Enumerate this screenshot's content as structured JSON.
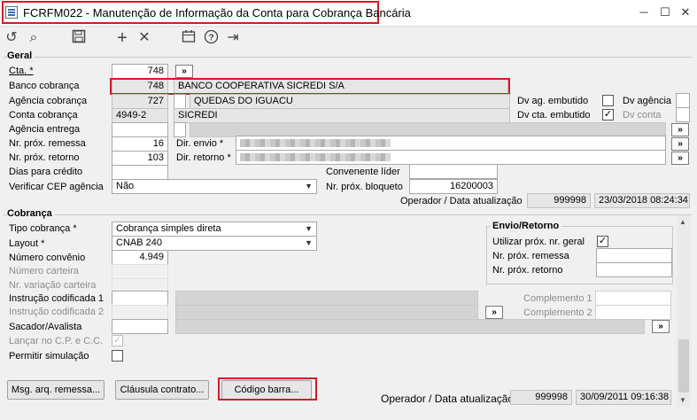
{
  "window": {
    "title": "FCRFM022 - Manutenção de Informação da Conta para Cobrança Bancária"
  },
  "toolbar": {
    "undo": "↺",
    "search": "⌕",
    "save": "💾",
    "add": "+",
    "close": "✕",
    "calendar": "📅",
    "help": "?",
    "exit": "⇥"
  },
  "geral": {
    "title": "Geral",
    "cta_label": "Cta. *",
    "cta_value": "748",
    "cta_btn": "»",
    "banco_label": "Banco cobrança",
    "banco_code": "748",
    "banco_name": "BANCO COOPERATIVA SICREDI S/A",
    "agencia_label": "Agência cobrança",
    "agencia_code": "727",
    "agencia_name": "QUEDAS DO IGUACU",
    "conta_label": "Conta cobrança",
    "conta_code": "4949-2",
    "conta_name": "SICREDI",
    "ag_entrega_label": "Agência entrega",
    "ag_entrega_btn": "»",
    "remessa_label": "Nr. próx. remessa",
    "remessa_value": "16",
    "retorno_label": "Nr. próx. retorno",
    "retorno_value": "103",
    "dias_label": "Dias para crédito",
    "cep_label": "Verificar CEP agência",
    "cep_value": "Não",
    "dir_envio_label": "Dir. envio *",
    "dir_retorno_label": "Dir. retorno *",
    "dir_btn": "»",
    "dv_ag_emb_label": "Dv ag. embutido",
    "dv_agencia_label": "Dv agência",
    "dv_cta_emb_label": "Dv cta. embutido",
    "dv_conta_label": "Dv conta",
    "convenente_label": "Convenente líder",
    "bloqueto_label": "Nr. próx. bloqueto",
    "bloqueto_value": "16200003",
    "operador_label": "Operador / Data atualização",
    "operador_value": "999998",
    "data_value": "23/03/2018 08:24:34"
  },
  "cobranca": {
    "title": "Cobrança",
    "tipo_label": "Tipo cobrança *",
    "tipo_value": "Cobrança simples direta",
    "layout_label": "Layout *",
    "layout_value": "CNAB 240",
    "convenio_label": "Número convênio",
    "convenio_value": "4.949",
    "carteira_label": "Número carteira",
    "var_carteira_label": "Nr. variação carteira",
    "instr1_label": "Instrução codificada 1",
    "instr2_label": "Instrução codificada 2",
    "sacador_label": "Sacador/Avalista",
    "lancar_label": "Lançar no C.P. e C.C.",
    "simulacao_label": "Permitir simulação",
    "compl1_label": "Complemento 1",
    "compl2_label": "Complemento 2",
    "btn_more": "»",
    "envio_title": "Envio/Retorno",
    "utilizar_label": "Utilizar próx. nr. geral",
    "env_remessa_label": "Nr. próx. remessa",
    "env_retorno_label": "Nr. próx. retorno",
    "btn_msg": "Msg. arq. remessa...",
    "btn_clausula": "Cláusula contrato...",
    "btn_codigo": "Código barra...",
    "operador_label": "Operador / Data atualização",
    "operador_value": "999998",
    "data_value": "30/09/2011 09:16:38"
  },
  "colors": {
    "highlight": "#d11a2a",
    "background": "#f0f0f0"
  }
}
